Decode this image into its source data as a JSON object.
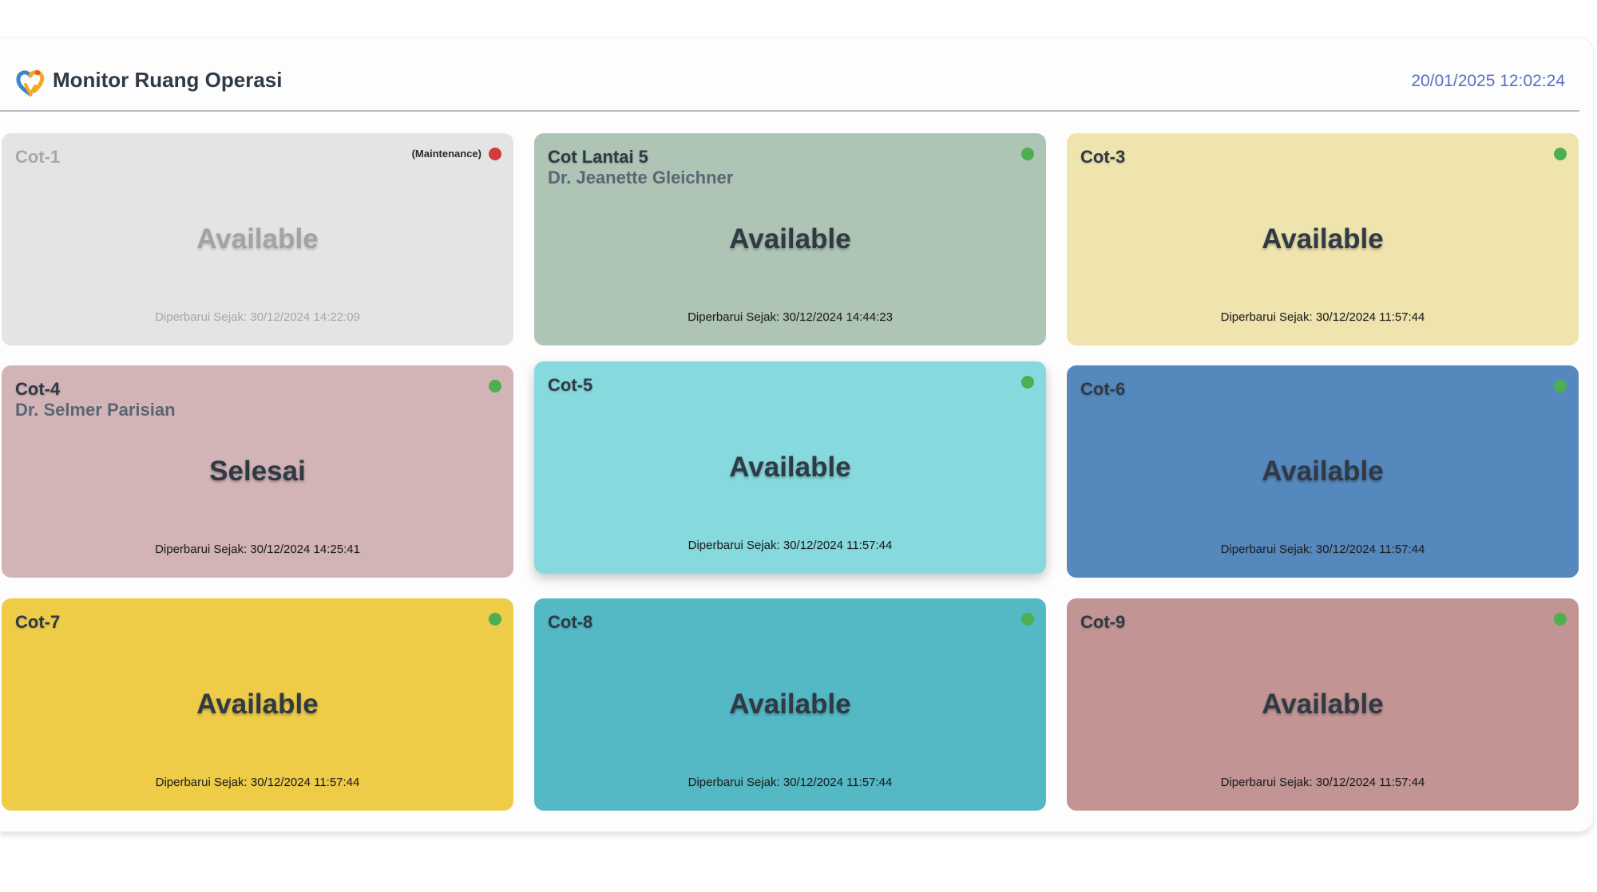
{
  "header": {
    "title": "Monitor Ruang Operasi",
    "datetime": "20/01/2025 12:02:24"
  },
  "updated_prefix": "Diperbarui Sejak: ",
  "rooms": [
    {
      "name": "Cot-1",
      "doctor": "",
      "note": "(Maintenance)",
      "status": "Available",
      "updated": "Diperbarui Sejak: 30/12/2024 14:22:09",
      "indicator": "red",
      "color": "#e4e4e4"
    },
    {
      "name": "Cot Lantai 5",
      "doctor": "Dr. Jeanette Gleichner",
      "note": "",
      "status": "Available",
      "updated": "Diperbarui Sejak: 30/12/2024 14:44:23",
      "indicator": "green",
      "color": "#aec4b4"
    },
    {
      "name": "Cot-3",
      "doctor": "",
      "note": "",
      "status": "Available",
      "updated": "Diperbarui Sejak: 30/12/2024 11:57:44",
      "indicator": "green",
      "color": "#f0e4ae"
    },
    {
      "name": "Cot-4",
      "doctor": "Dr. Selmer Parisian",
      "note": "",
      "status": "Selesai",
      "updated": "Diperbarui Sejak: 30/12/2024 14:25:41",
      "indicator": "green",
      "color": "#d3b4b6"
    },
    {
      "name": "Cot-5",
      "doctor": "",
      "note": "",
      "status": "Available",
      "updated": "Diperbarui Sejak: 30/12/2024 11:57:44",
      "indicator": "green",
      "color": "#86d9dd"
    },
    {
      "name": "Cot-6",
      "doctor": "",
      "note": "",
      "status": "Available",
      "updated": "Diperbarui Sejak: 30/12/2024 11:57:44",
      "indicator": "green",
      "color": "#5588bd"
    },
    {
      "name": "Cot-7",
      "doctor": "",
      "note": "",
      "status": "Available",
      "updated": "Diperbarui Sejak: 30/12/2024 11:57:44",
      "indicator": "green",
      "color": "#efcc48"
    },
    {
      "name": "Cot-8",
      "doctor": "",
      "note": "",
      "status": "Available",
      "updated": "Diperbarui Sejak: 30/12/2024 11:57:44",
      "indicator": "green",
      "color": "#54b9c5"
    },
    {
      "name": "Cot-9",
      "doctor": "",
      "note": "",
      "status": "Available",
      "updated": "Diperbarui Sejak: 30/12/2024 11:57:44",
      "indicator": "green",
      "color": "#c29494"
    }
  ]
}
